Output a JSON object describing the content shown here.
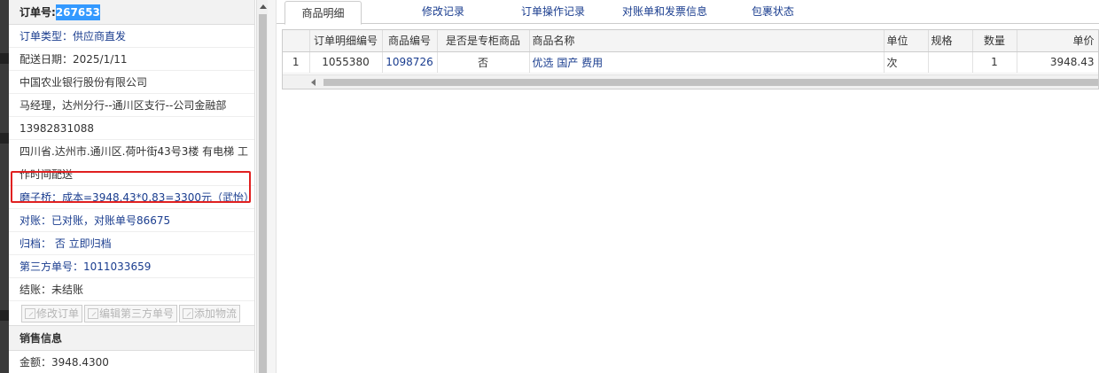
{
  "order": {
    "label": "订单号:",
    "number": "267653"
  },
  "info_rows": [
    {
      "text": "订单类型：供应商直发",
      "style": "blue"
    },
    {
      "text": "配送日期：2025/1/11",
      "style": "normal"
    },
    {
      "text": "中国农业银行股份有限公司",
      "style": "normal"
    },
    {
      "text": "马经理，达州分行--通川区支行--公司金融部",
      "style": "normal"
    },
    {
      "text": "13982831088",
      "style": "normal"
    },
    {
      "text": "四川省.达州市.通川区.荷叶街43号3楼 有电梯 工作时间配送",
      "style": "addr"
    },
    {
      "text": "磨子桥：成本=3948.43*0.83=3300元（武怡）",
      "style": "blue"
    },
    {
      "text": "对账：已对账，对账单号86675",
      "style": "blue"
    },
    {
      "text": "归档： 否 立即归档",
      "style": "blue"
    },
    {
      "text": "第三方单号：1011033659",
      "style": "blue"
    },
    {
      "text": "结账：未结账",
      "style": "normal"
    }
  ],
  "buttons": {
    "edit_order": "修改订单",
    "edit_third_party": "编辑第三方单号",
    "add_logistics": "添加物流"
  },
  "sales": {
    "title": "销售信息",
    "amount": "金额：3948.4300"
  },
  "tabs": [
    {
      "label": "商品明细",
      "active": true
    },
    {
      "label": "修改记录",
      "active": false
    },
    {
      "label": "订单操作记录",
      "active": false
    },
    {
      "label": "对账单和发票信息",
      "active": false
    },
    {
      "label": "包裹状态",
      "active": false
    }
  ],
  "table": {
    "headers": [
      "",
      "订单明细编号",
      "商品编号",
      "是否是专柜商品",
      "商品名称",
      "单位",
      "规格",
      "数量",
      "单价"
    ],
    "rows": [
      [
        "1",
        "1055380",
        "1098726",
        "否",
        "优选 国产 费用",
        "次",
        "",
        "1",
        "3948.43"
      ]
    ]
  },
  "colors": {
    "link_blue": "#1a3d8f",
    "highlight_blue": "#3399ff",
    "annotation_red": "#e02020"
  }
}
